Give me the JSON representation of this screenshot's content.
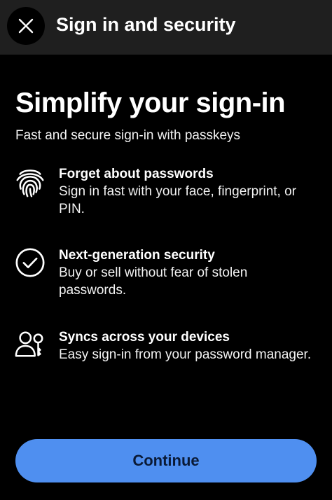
{
  "header": {
    "title": "Sign in and security",
    "close_icon": "close-icon"
  },
  "hero": {
    "title": "Simplify your sign-in",
    "subtitle": "Fast and secure sign-in with passkeys"
  },
  "features": [
    {
      "icon": "fingerprint-icon",
      "title": "Forget about passwords",
      "description": "Sign in fast with your face, fingerprint, or PIN."
    },
    {
      "icon": "check-circle-icon",
      "title": "Next-generation security",
      "description": "Buy or sell without fear of stolen passwords."
    },
    {
      "icon": "users-key-icon",
      "title": "Syncs across your devices",
      "description": "Easy sign-in from your password manager."
    }
  ],
  "continue_button": {
    "label": "Continue"
  },
  "colors": {
    "background": "#000000",
    "header_background": "#1f1f1f",
    "button_background": "#4f8ff0",
    "button_text": "#0a1a36",
    "text": "#ffffff"
  }
}
